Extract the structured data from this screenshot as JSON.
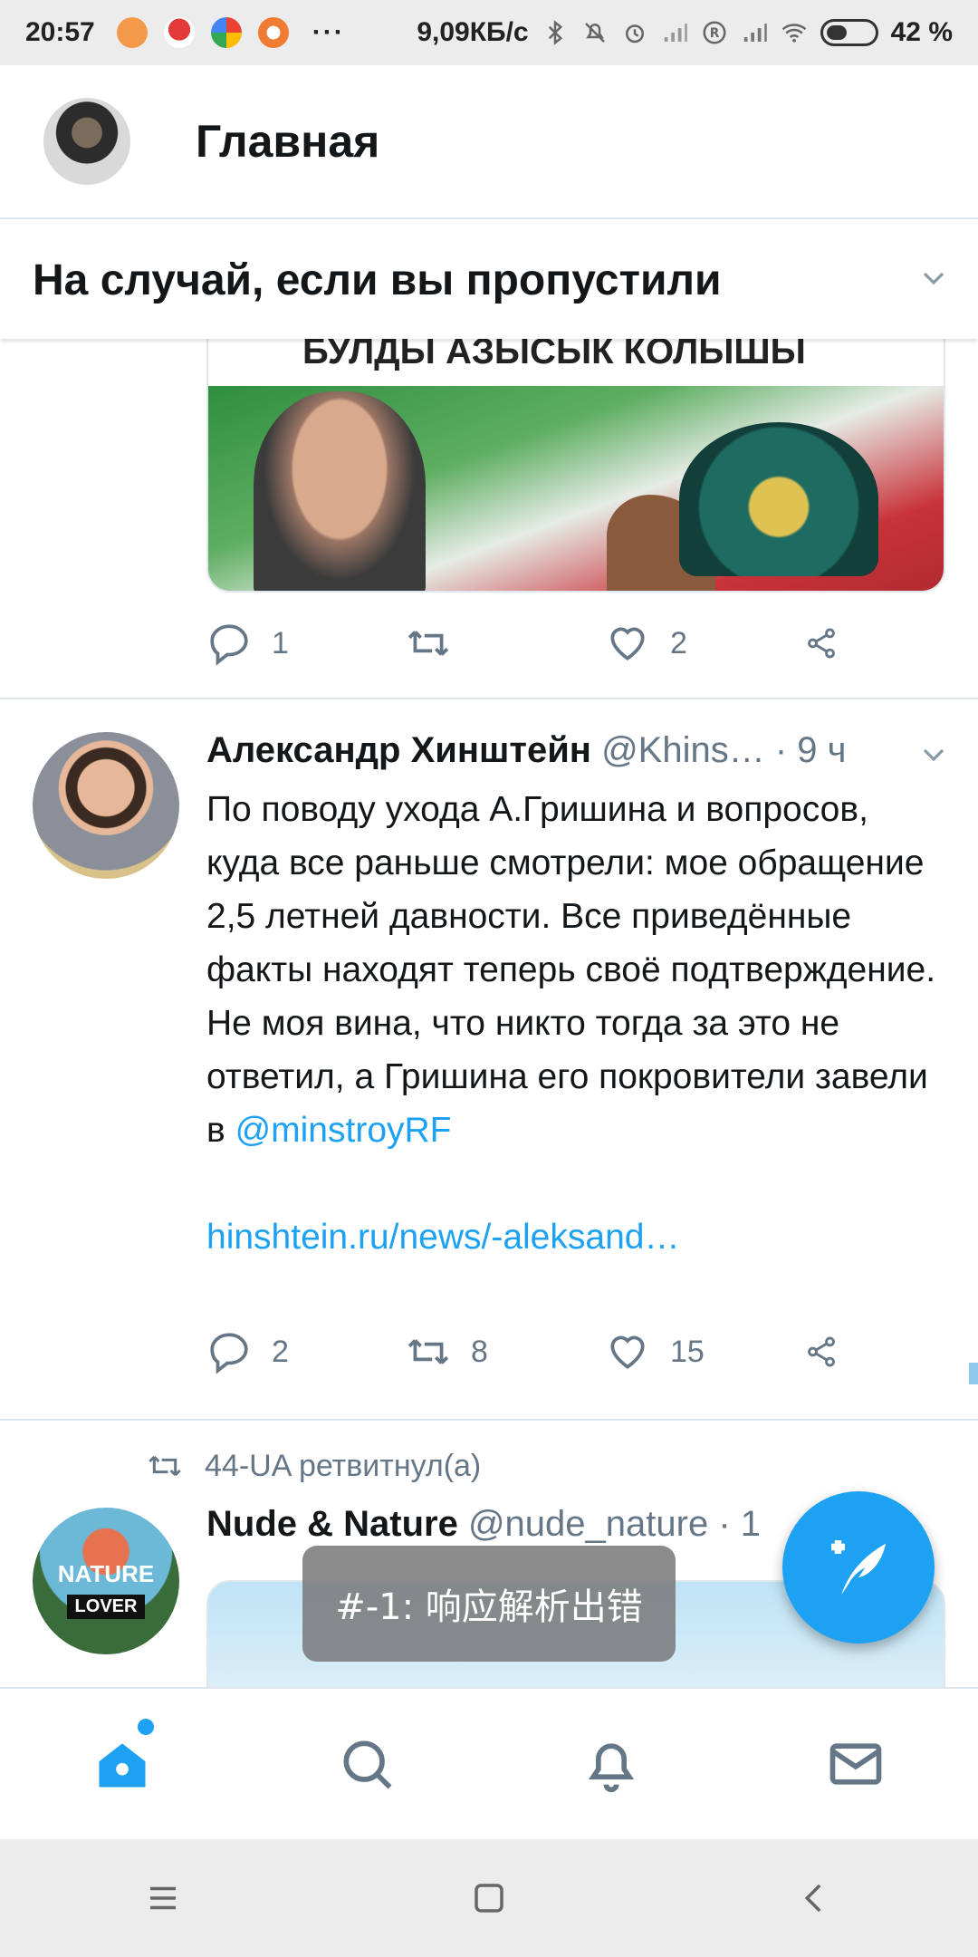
{
  "status_bar": {
    "time": "20:57",
    "dots": "···",
    "network_speed": "9,09КБ/с",
    "battery": "42 %"
  },
  "header": {
    "title": "Главная"
  },
  "section": {
    "title": "На случай, если вы пропустили"
  },
  "tweets": [
    {
      "card_caption": "БУЛДЫ АЗЫСЫК КОЛЫШЫ",
      "replies": "1",
      "retweets": "",
      "likes": "2"
    },
    {
      "name": "Александр Хинштейн",
      "handle": "@Khins…",
      "time": "· 9 ч",
      "text": "По поводу ухода А.Гришина и вопросов, куда все раньше смотрели: мое обращение 2,5 летней давности. Все приведённые факты находят теперь своё подтверждение. Не моя вина, что никто тогда за это не ответил, а Гришина его покровители завели в ",
      "mention": "@minstroyRF",
      "link": "hinshtein.ru/news/-aleksand…",
      "replies": "2",
      "retweets": "8",
      "likes": "15"
    },
    {
      "retweeted_by": "44-UA ретвитнул(а)",
      "name": "Nude & Nature",
      "handle": "@nude_nature",
      "time": "· 1",
      "avatar_text_1": "NATURE",
      "avatar_text_2": "LOVER"
    }
  ],
  "toast": {
    "text": "#-1: 响应解析出错"
  },
  "icons": {
    "reply": "reply-icon",
    "retweet": "retweet-icon",
    "like": "heart-icon",
    "share": "share-icon",
    "compose": "compose-tweet-icon",
    "home": "home-icon",
    "search": "search-icon",
    "notifications": "bell-icon",
    "messages": "mail-icon"
  },
  "colors": {
    "accent": "#1da1f2",
    "secondary_text": "#657786",
    "divider": "#e1e8ed"
  }
}
